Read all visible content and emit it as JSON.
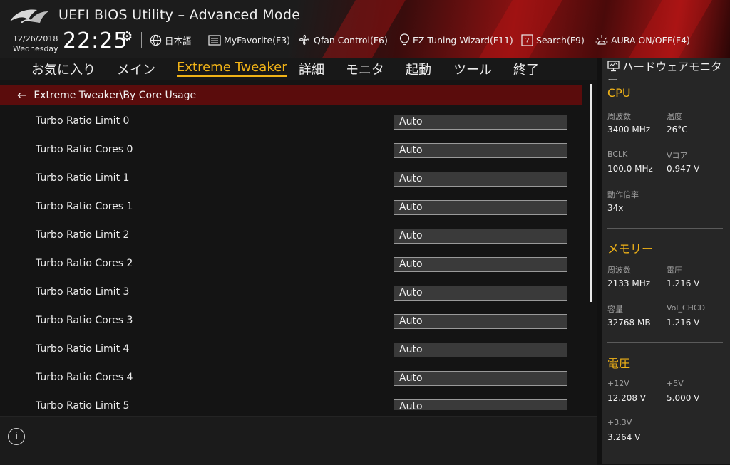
{
  "header": {
    "title": "UEFI BIOS Utility – Advanced Mode",
    "date": "12/26/2018",
    "weekday": "Wednesday",
    "time": "22:25",
    "toolbar": {
      "language": "日本語",
      "myfavorite": "MyFavorite(F3)",
      "qfan": "Qfan Control(F6)",
      "ez_tuning": "EZ Tuning Wizard(F11)",
      "search": "Search(F9)",
      "aura": "AURA ON/OFF(F4)"
    }
  },
  "nav": {
    "tabs": [
      "お気に入り",
      "メイン",
      "Extreme Tweaker",
      "詳細",
      "モニタ",
      "起動",
      "ツール",
      "終了"
    ],
    "active": "Extreme Tweaker"
  },
  "breadcrumb": "Extreme Tweaker\\By Core Usage",
  "settings": [
    {
      "label": "Turbo Ratio Limit 0",
      "value": "Auto"
    },
    {
      "label": "Turbo Ratio Cores 0",
      "value": "Auto"
    },
    {
      "label": "Turbo Ratio Limit 1",
      "value": "Auto"
    },
    {
      "label": "Turbo Ratio Cores 1",
      "value": "Auto"
    },
    {
      "label": "Turbo Ratio Limit 2",
      "value": "Auto"
    },
    {
      "label": "Turbo Ratio Cores 2",
      "value": "Auto"
    },
    {
      "label": "Turbo Ratio Limit 3",
      "value": "Auto"
    },
    {
      "label": "Turbo Ratio Cores 3",
      "value": "Auto"
    },
    {
      "label": "Turbo Ratio Limit 4",
      "value": "Auto"
    },
    {
      "label": "Turbo Ratio Cores 4",
      "value": "Auto"
    },
    {
      "label": "Turbo Ratio Limit 5",
      "value": "Auto"
    }
  ],
  "info_icon": "info-icon",
  "hw_monitor": {
    "title": "ハードウェアモニター",
    "cpu": {
      "heading": "CPU",
      "freq_label": "周波数",
      "freq": "3400 MHz",
      "temp_label": "温度",
      "temp": "26°C",
      "bclk_label": "BCLK",
      "bclk": "100.0 MHz",
      "vcore_label": "Vコア",
      "vcore": "0.947 V",
      "ratio_label": "動作倍率",
      "ratio": "34x"
    },
    "memory": {
      "heading": "メモリー",
      "freq_label": "周波数",
      "freq": "2133 MHz",
      "volt_label": "電圧",
      "volt": "1.216 V",
      "cap_label": "容量",
      "cap": "32768 MB",
      "chcd_label": "Vol_CHCD",
      "chcd": "1.216 V"
    },
    "voltage": {
      "heading": "電圧",
      "v12_label": "+12V",
      "v12": "12.208 V",
      "v5_label": "+5V",
      "v5": "5.000 V",
      "v33_label": "+3.3V",
      "v33": "3.264 V"
    }
  },
  "colors": {
    "accent": "#f1b317",
    "breadcrumb_bg": "#5a0c0c",
    "header_red": "#8a1212"
  }
}
